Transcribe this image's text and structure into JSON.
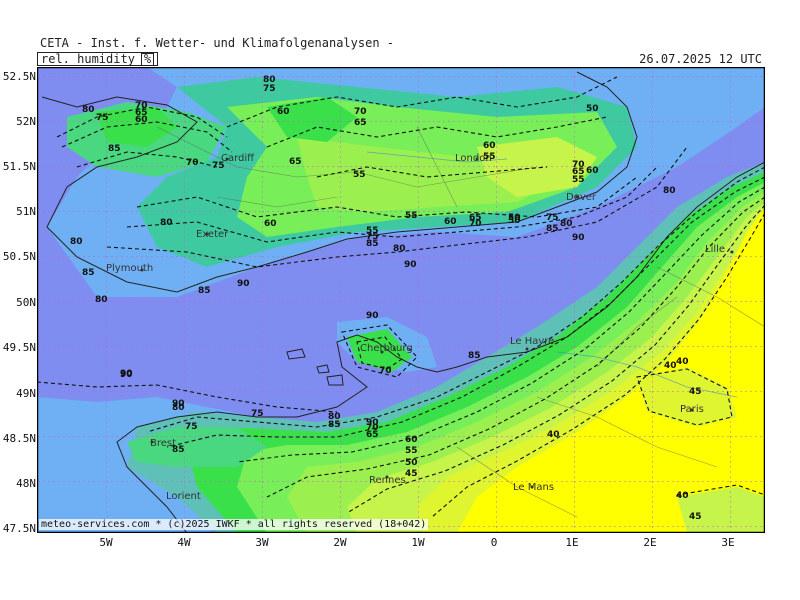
{
  "header": {
    "title": "CETA - Inst. f. Wetter- und Klimafolgenanalysen -",
    "run_time": "26.07.2025 12 UTC"
  },
  "parameter": {
    "label": "rel. humidity",
    "unit": "%"
  },
  "footer": "meteo-services.com * (c)2025 IWKF * all rights reserved (18+042)",
  "axes": {
    "lat_labels": [
      "52.5N",
      "52N",
      "51.5N",
      "51N",
      "50.5N",
      "50N",
      "49.5N",
      "49N",
      "48.5N",
      "48N",
      "47.5N"
    ],
    "lon_labels": [
      "5W",
      "4W",
      "3W",
      "2W",
      "1W",
      "0",
      "1E",
      "2E",
      "3E"
    ]
  },
  "colors": {
    "sea": "#7f8cf0",
    "rh_90": "#6fb0f5",
    "rh_85": "#5fc0b8",
    "rh_80": "#3fc9a0",
    "rh_75": "#49d880",
    "rh_70": "#3ae04a",
    "rh_60": "#78ee58",
    "rh_55": "#9bf04f",
    "rh_50": "#c6f44a",
    "rh_45": "#dff530",
    "rh_40": "#ffff00",
    "frame": "#000000"
  },
  "cities": [
    {
      "name": "Cardiff"
    },
    {
      "name": "London"
    },
    {
      "name": "Dover"
    },
    {
      "name": "Exeter"
    },
    {
      "name": "Plymouth"
    },
    {
      "name": "Lille"
    },
    {
      "name": "Cherbourg"
    },
    {
      "name": "Le Havre"
    },
    {
      "name": "Paris"
    },
    {
      "name": "Brest"
    },
    {
      "name": "Rennes"
    },
    {
      "name": "Le Mans"
    },
    {
      "name": "Lorient"
    }
  ],
  "contour_labels": [
    "80",
    "75",
    "70",
    "65",
    "60",
    "80",
    "75",
    "60",
    "70",
    "65",
    "85",
    "70",
    "75",
    "65",
    "55",
    "60",
    "55",
    "50",
    "70",
    "65",
    "55",
    "60",
    "80",
    "50",
    "60",
    "65",
    "70",
    "75",
    "80",
    "85",
    "90",
    "55",
    "60",
    "55",
    "50",
    "75",
    "85",
    "80",
    "90",
    "85",
    "80",
    "80",
    "85",
    "90",
    "90",
    "80",
    "90",
    "90",
    "85",
    "70",
    "80",
    "85",
    "90",
    "60",
    "55",
    "50",
    "45",
    "40",
    "45",
    "40",
    "40",
    "40",
    "45",
    "90",
    "75",
    "80",
    "85",
    "70",
    "65",
    "75"
  ]
}
